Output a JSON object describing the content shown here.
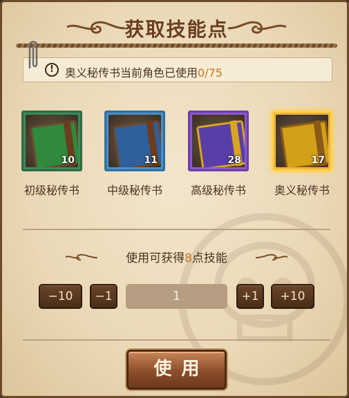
{
  "dialog": {
    "title": "获取技能点",
    "notice": {
      "text": "奥义秘传书当前角色已使用",
      "count": "0/75"
    }
  },
  "items": [
    {
      "name": "初级秘传书",
      "quantity": "10",
      "frame_color": "#3b8a5a",
      "cover_color": "#2f8a3c",
      "selected": false
    },
    {
      "name": "中级秘传书",
      "quantity": "11",
      "frame_color": "#4b8fc8",
      "cover_color": "#2f5f9c",
      "selected": false
    },
    {
      "name": "高级秘传书",
      "quantity": "28",
      "frame_color": "#8a5ac8",
      "cover_color": "#5a3ea8",
      "selected": false
    },
    {
      "name": "奥义秘传书",
      "quantity": "17",
      "frame_color": "#f0b43c",
      "cover_color": "#d4a018",
      "selected": true
    }
  ],
  "gain": {
    "prefix": "使用可获得",
    "points": "8",
    "suffix": "点技能"
  },
  "stepper": {
    "minus10": "−10",
    "minus1": "−1",
    "value": "1",
    "plus1": "+1",
    "plus10": "+10"
  },
  "use_button": "使用"
}
